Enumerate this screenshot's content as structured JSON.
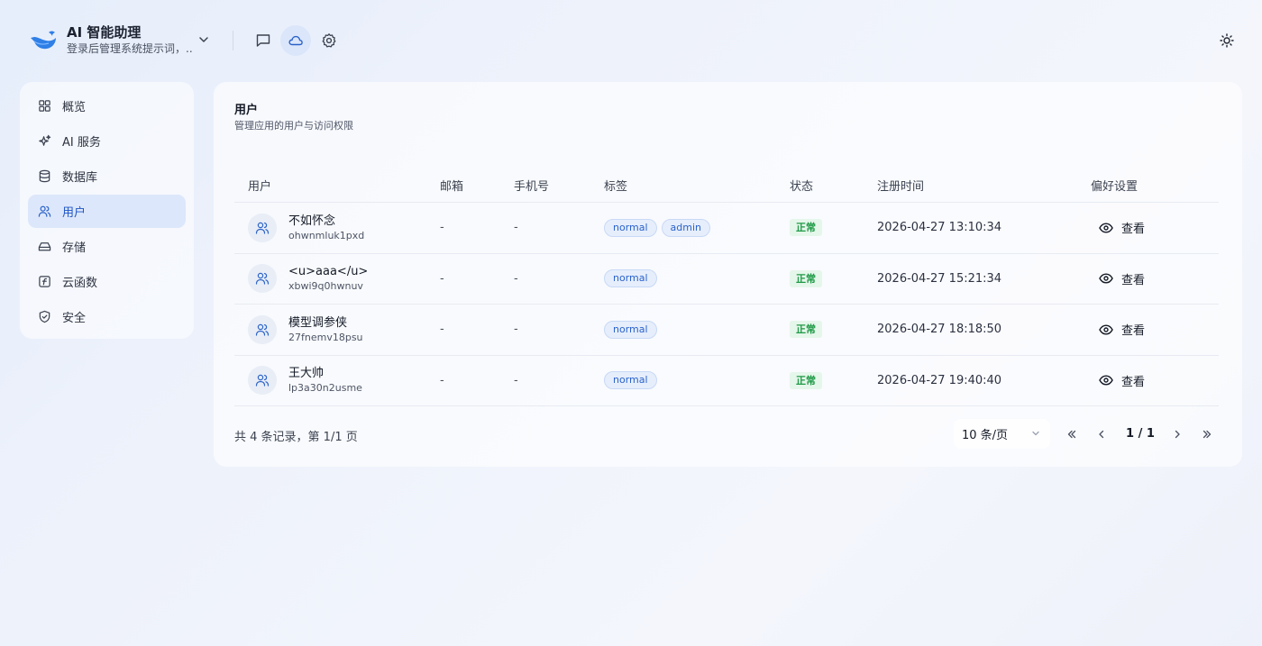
{
  "app": {
    "title": "AI 智能助理",
    "subtitle": "登录后管理系统提示词，..."
  },
  "header": {
    "icons": [
      "chat-icon",
      "cloud-icon",
      "gear-icon",
      "sun-icon"
    ],
    "active_icon": "cloud-icon"
  },
  "sidebar": {
    "items": [
      {
        "label": "概览",
        "icon": "grid-icon"
      },
      {
        "label": "AI 服务",
        "icon": "sparkle-icon"
      },
      {
        "label": "数据库",
        "icon": "database-icon"
      },
      {
        "label": "用户",
        "icon": "users-icon",
        "active": true
      },
      {
        "label": "存储",
        "icon": "hard-drive-icon"
      },
      {
        "label": "云函数",
        "icon": "function-icon"
      },
      {
        "label": "安全",
        "icon": "shield-icon"
      }
    ]
  },
  "page": {
    "title": "用户",
    "subtitle": "管理应用的用户与访问权限"
  },
  "table": {
    "columns": [
      "用户",
      "邮箱",
      "手机号",
      "标签",
      "状态",
      "注册时间",
      "偏好设置"
    ],
    "rows": [
      {
        "name": "不如怀念",
        "id": "ohwnmluk1pxd",
        "email": "-",
        "phone": "-",
        "tags": [
          "normal",
          "admin"
        ],
        "status": "正常",
        "registered": "2026-04-27 13:10:34",
        "action": "查看"
      },
      {
        "name": "<u>aaa</u>",
        "id": "xbwi9q0hwnuv",
        "email": "-",
        "phone": "-",
        "tags": [
          "normal"
        ],
        "status": "正常",
        "registered": "2026-04-27 15:21:34",
        "action": "查看"
      },
      {
        "name": "模型调参侠",
        "id": "27fnemv18psu",
        "email": "-",
        "phone": "-",
        "tags": [
          "normal"
        ],
        "status": "正常",
        "registered": "2026-04-27 18:18:50",
        "action": "查看"
      },
      {
        "name": "王大帅",
        "id": "lp3a30n2usme",
        "email": "-",
        "phone": "-",
        "tags": [
          "normal"
        ],
        "status": "正常",
        "registered": "2026-04-27 19:40:40",
        "action": "查看"
      }
    ]
  },
  "pagination": {
    "summary": "共 4 条记录，第 1/1 页",
    "page_size": "10 条/页",
    "page_info": "1 / 1"
  },
  "colors": {
    "accent": "#2b63c9",
    "active_bg": "#dde7fb",
    "status_green": "#1e9a46"
  }
}
